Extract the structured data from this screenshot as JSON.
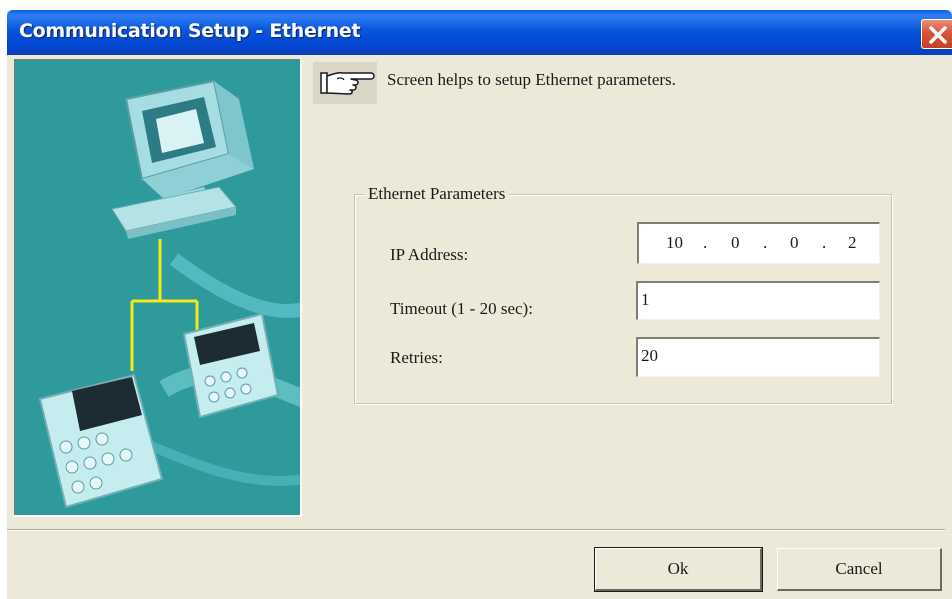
{
  "window": {
    "title": "Communication Setup - Ethernet"
  },
  "hint": {
    "icon": "pointing-hand-icon",
    "text": "Screen helps to setup Ethernet parameters."
  },
  "ethernet_params": {
    "title": "Ethernet Parameters",
    "ip_label": "IP Address:",
    "ip_octets": [
      "10",
      "0",
      "0",
      "2"
    ],
    "ip_separator": ".",
    "timeout_label": "Timeout  (1 - 20 sec):",
    "timeout_value": "1",
    "retries_label": "Retries:",
    "retries_value": "20"
  },
  "buttons": {
    "ok": "Ok",
    "cancel": "Cancel"
  },
  "colors": {
    "titlebar": "#0855dd",
    "illustration_bg": "#2e9a9c",
    "dialog_bg": "#ece9d8",
    "cable": "#f2ea1a"
  }
}
